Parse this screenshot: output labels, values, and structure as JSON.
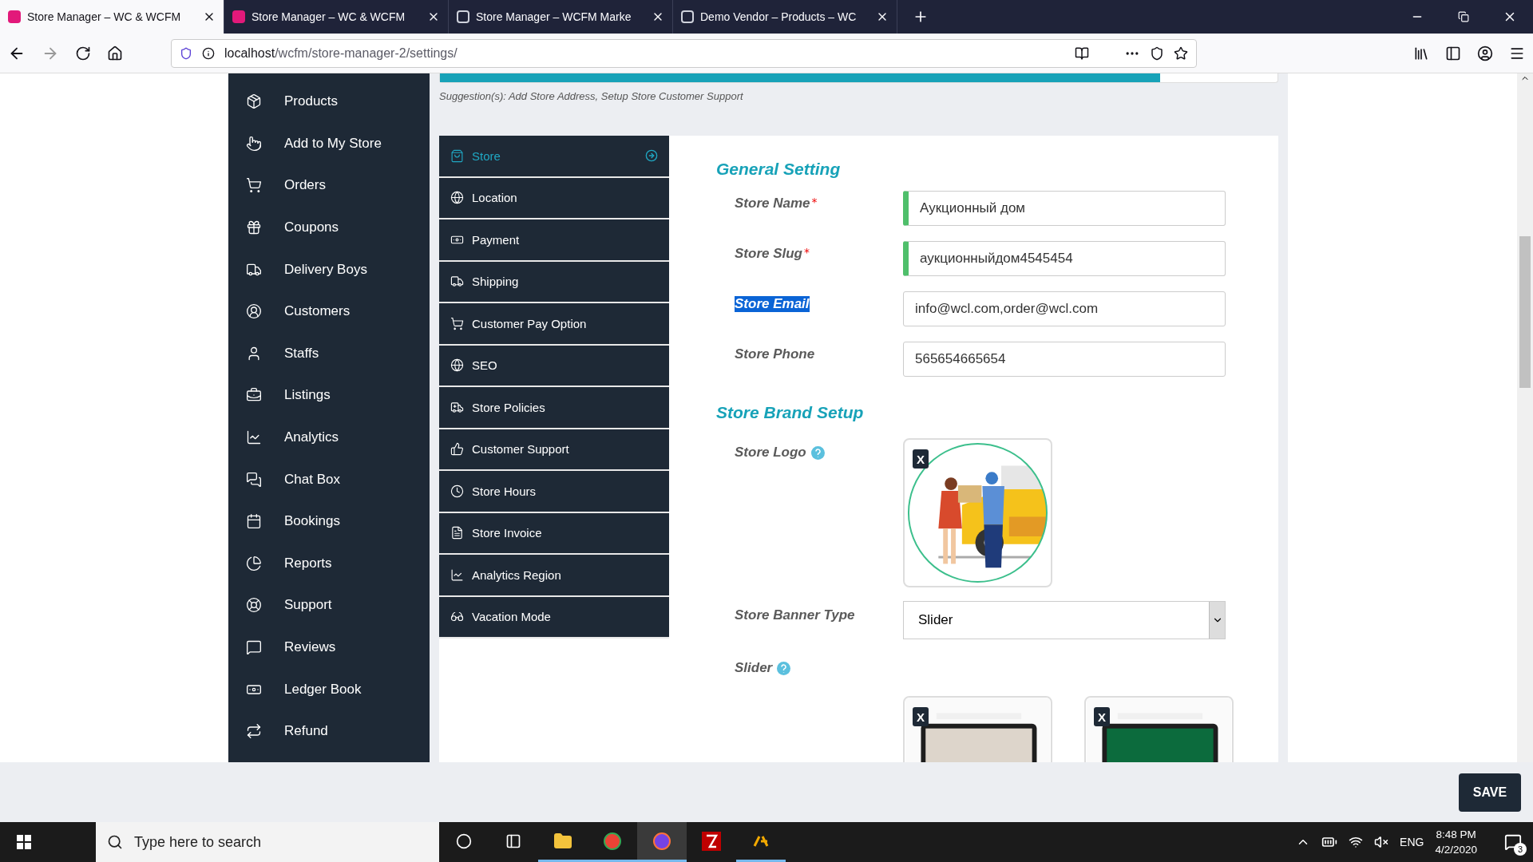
{
  "browser": {
    "tabs": [
      {
        "title": "Store Manager – WC & WCFM",
        "selected": true,
        "kind": "brand"
      },
      {
        "title": "Store Manager – WC & WCFM",
        "selected": false,
        "kind": "brand"
      },
      {
        "title": "Store Manager – WCFM Marke",
        "selected": false,
        "kind": "page"
      },
      {
        "title": "Demo Vendor – Products – WC",
        "selected": false,
        "kind": "page"
      }
    ],
    "url_host": "localhost",
    "url_path": "/wcfm/store-manager-2/settings/"
  },
  "sidebar": {
    "items": [
      {
        "label": "Products"
      },
      {
        "label": "Add to My Store"
      },
      {
        "label": "Orders"
      },
      {
        "label": "Coupons"
      },
      {
        "label": "Delivery Boys"
      },
      {
        "label": "Customers"
      },
      {
        "label": "Staffs"
      },
      {
        "label": "Listings"
      },
      {
        "label": "Analytics"
      },
      {
        "label": "Chat Box"
      },
      {
        "label": "Bookings"
      },
      {
        "label": "Reports"
      },
      {
        "label": "Support"
      },
      {
        "label": "Reviews"
      },
      {
        "label": "Ledger Book"
      },
      {
        "label": "Refund"
      }
    ]
  },
  "profile_progress": {
    "level": 0.86
  },
  "suggestion": "Suggestion(s): Add Store Address, Setup Store Customer Support",
  "settings_menu": [
    {
      "label": "Store",
      "selected": true
    },
    {
      "label": "Location",
      "selected": false
    },
    {
      "label": "Payment",
      "selected": false
    },
    {
      "label": "Shipping",
      "selected": false
    },
    {
      "label": "Customer Pay Option",
      "selected": false
    },
    {
      "label": "SEO",
      "selected": false
    },
    {
      "label": "Store Policies",
      "selected": false
    },
    {
      "label": "Customer Support",
      "selected": false
    },
    {
      "label": "Store Hours",
      "selected": false
    },
    {
      "label": "Store Invoice",
      "selected": false
    },
    {
      "label": "Analytics Region",
      "selected": false
    },
    {
      "label": "Vacation Mode",
      "selected": false
    }
  ],
  "general_setting": {
    "heading": "General Setting",
    "fields": [
      {
        "label": "Store Name",
        "required_mark": "*",
        "value": "Аукционный дом",
        "validated": true,
        "highlighted": false
      },
      {
        "label": "Store Slug",
        "required_mark": "*",
        "value": "аукционныйдом4545454",
        "validated": true,
        "highlighted": false
      },
      {
        "label": "Store Email",
        "value": "info@wcl.com,order@wcl.com",
        "validated": false,
        "highlighted": true
      },
      {
        "label": "Store Phone",
        "value": "565654665654",
        "validated": false,
        "highlighted": false
      }
    ]
  },
  "brand_setup": {
    "heading": "Store Brand Setup",
    "logo": {
      "label": "Store Logo",
      "remove": "X"
    },
    "banner_type": {
      "label": "Store Banner Type",
      "value": "Slider"
    },
    "slider": {
      "label": "Slider",
      "images": [
        {
          "remove": "X",
          "kind": "picture"
        },
        {
          "remove": "X",
          "kind": "picture"
        }
      ]
    }
  },
  "save_button": "SAVE",
  "taskbar": {
    "search_placeholder": "Type here to search",
    "language": "ENG",
    "time": "8:48 PM",
    "date": "4/2/2020",
    "notifications": "3"
  }
}
